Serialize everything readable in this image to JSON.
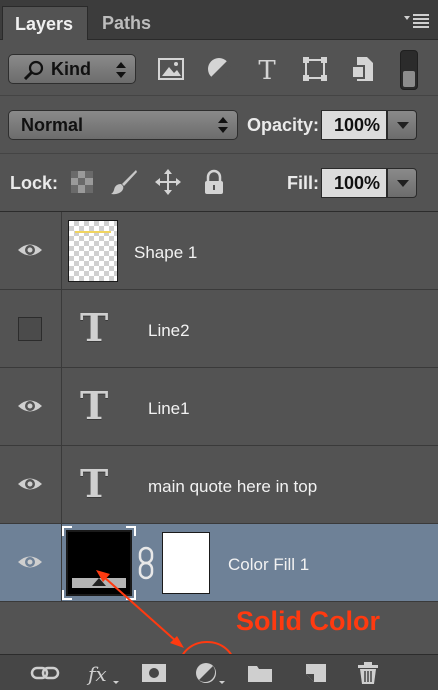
{
  "tabs": [
    {
      "label": "Layers",
      "active": true
    },
    {
      "label": "Paths",
      "active": false
    }
  ],
  "filter": {
    "kind_label": "Kind",
    "icons": [
      "image-filter-icon",
      "adjustment-filter-icon",
      "type-filter-icon",
      "shape-filter-icon",
      "smart-object-filter-icon"
    ]
  },
  "blend": {
    "mode": "Normal",
    "opacity_label": "Opacity:",
    "opacity_value": "100%"
  },
  "lock": {
    "label": "Lock:",
    "icons": [
      "lock-transparent-pixels-icon",
      "lock-image-pixels-icon",
      "lock-position-icon",
      "lock-all-icon"
    ],
    "fill_label": "Fill:",
    "fill_value": "100%"
  },
  "layers": [
    {
      "name": "Shape 1",
      "type": "shape",
      "visible": true,
      "selected": false
    },
    {
      "name": "Line2",
      "type": "text",
      "visible": false,
      "selected": false
    },
    {
      "name": "Line1",
      "type": "text",
      "visible": true,
      "selected": false
    },
    {
      "name": "main quote here in top",
      "type": "text",
      "visible": true,
      "selected": false
    },
    {
      "name": "Color Fill 1",
      "type": "fill",
      "visible": true,
      "selected": true
    }
  ],
  "bottom_icons": [
    "link-layers-icon",
    "layer-style-icon",
    "add-mask-icon",
    "new-fill-adjustment-icon",
    "new-group-icon",
    "new-layer-icon",
    "delete-layer-icon"
  ],
  "annotation": {
    "text": "Solid Color",
    "color": "#ff3a10"
  },
  "colors": {
    "panel": "#535353",
    "selected_row": "#6e8197"
  }
}
